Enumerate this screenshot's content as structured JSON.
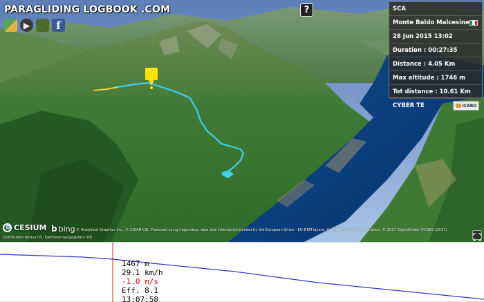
{
  "header": {
    "title": "PARAGLIDING LOGBOOK .COM"
  },
  "share_buttons": [
    {
      "name": "google-maps-icon",
      "glyph": ""
    },
    {
      "name": "youtube-icon",
      "glyph": "▶"
    },
    {
      "name": "game-controller-icon",
      "glyph": ""
    },
    {
      "name": "facebook-icon",
      "glyph": "f"
    }
  ],
  "help": {
    "label": "?"
  },
  "flight": {
    "pilot": "SCA",
    "site": "Monte Baldo Malcesine",
    "site_flag_colors": [
      "#009246",
      "#ffffff",
      "#ce2b37"
    ],
    "datetime": "28 Jun 2015 13:02",
    "duration": "Duration : 00:27:35",
    "distance": "Distance : 4.05 Km",
    "max_altitude": "Max altitude : 1746 m",
    "total_distance": "Tot distance : 10.61 Km",
    "wing": "CYBER TE",
    "wing_brand": "ICARO"
  },
  "attribution": {
    "cesium": "CESIUM",
    "bing": "bing",
    "credits": "© Analytical Graphics Inc., © CGIAR-CSI, Produced using Copernicus data and information funded by the European Union - EU-DEM layers, © 2017 Microsoft Corporation, © 2017 DigitalGlobe ©CNES (2017)",
    "credits2": "Distribution Airbus DS, Earthstar Geographics SIO"
  },
  "profile": {
    "altitude": "1467 m",
    "speed": "29.1 km/h",
    "vario": "-1.0 m/s",
    "efficiency": "Eff. 8.1",
    "time": "13:07:58",
    "cursor_fraction": 0.233,
    "line_color": "#3333cc",
    "cursor_color": "#dd2222"
  },
  "colors": {
    "track": "#3fd0f0",
    "track_start": "#f2d23a",
    "marker": "#ffe400",
    "lake": "#0a3c7a"
  }
}
